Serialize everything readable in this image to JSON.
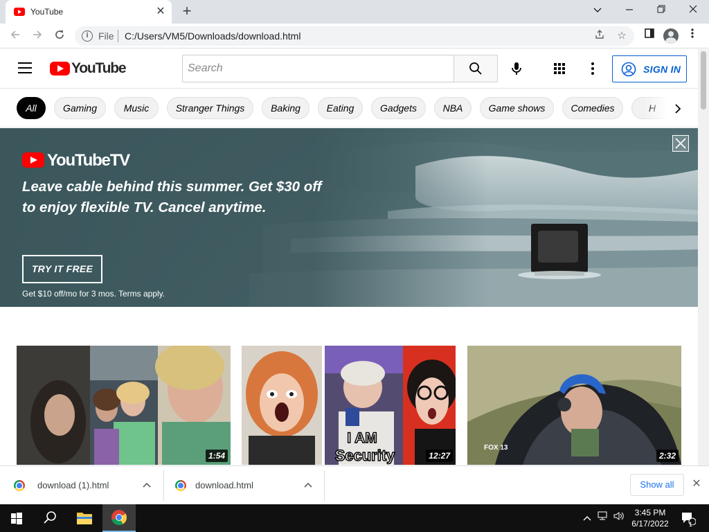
{
  "browser": {
    "tab_title": "YouTube",
    "address_scheme": "File",
    "address_url": "C:/Users/VM5/Downloads/download.html"
  },
  "youtube": {
    "logo_text": "YouTube",
    "search_placeholder": "Search",
    "sign_in_label": "SIGN IN",
    "chips": [
      "All",
      "Gaming",
      "Music",
      "Stranger Things",
      "Baking",
      "Eating",
      "Gadgets",
      "NBA",
      "Game shows",
      "Comedies",
      "H"
    ],
    "active_chip": "All"
  },
  "banner": {
    "logo_text": "YouTubeTV",
    "headline_line1": "Leave cable behind this summer. Get $30 off",
    "headline_line2": "to enjoy flexible TV. Cancel anytime.",
    "cta_label": "TRY IT FREE",
    "terms": "Get $10 off/mo for 3 mos. Terms apply."
  },
  "videos": [
    {
      "duration": "1:54"
    },
    {
      "duration": "12:27",
      "thumbnail_text": [
        "I AM",
        "Security"
      ]
    },
    {
      "duration": "2:32",
      "thumbnail_text": [
        "FOX 13"
      ]
    }
  ],
  "downloads": {
    "items": [
      {
        "name": "download (1).html"
      },
      {
        "name": "download.html"
      }
    ],
    "show_all_label": "Show all"
  },
  "taskbar": {
    "time": "3:45 PM",
    "date": "6/17/2022",
    "notification_count": "1"
  },
  "colors": {
    "youtube_red": "#ff0000",
    "link_blue": "#065fd4",
    "chrome_blue": "#1a73e8",
    "banner_teal": "#3f5c61"
  }
}
